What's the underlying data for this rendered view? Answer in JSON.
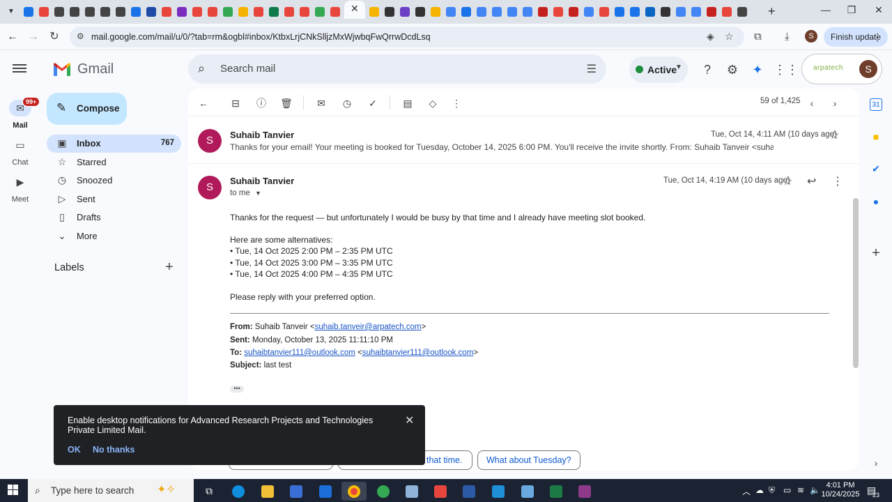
{
  "browser": {
    "url": "mail.google.com/mail/u/0/?tab=rm&ogbl#inbox/KtbxLrjCNkSlljzMxWjwbqFwQrrwDcdLsq",
    "finish_update_label": "Finish update",
    "profile_initial": "S",
    "tab_favicons": [
      "#1a73e8",
      "#e8453c",
      "#444",
      "#444",
      "#444",
      "#444",
      "#444",
      "#1a73e8",
      "#1f4aa8",
      "#e8453c",
      "#7b2cbf",
      "#e8453c",
      "#e8453c",
      "#34a853",
      "#f4b400",
      "#e8453c",
      "#0f7b4a",
      "#e8453c",
      "#e8453c",
      "#34a853",
      "#e8453c"
    ],
    "tab_favicons_right": [
      "#f4b400",
      "#333",
      "#6c3fc5",
      "#333",
      "#f4b400",
      "#4285f4",
      "#1a73e8",
      "#4285f4",
      "#4285f4",
      "#4285f4",
      "#4285f4",
      "#c5221f",
      "#e8453c",
      "#c5221f",
      "#4285f4",
      "#e8453c",
      "#1a73e8",
      "#1a73e8",
      "#0a66c2",
      "#333",
      "#4285f4",
      "#4285f4",
      "#c5221f",
      "#e8453c",
      "#444"
    ]
  },
  "gmail": {
    "product_name": "Gmail",
    "search_placeholder": "Search mail",
    "status_label": "Active",
    "org_label": "arpatech",
    "account_initial": "S"
  },
  "rail": {
    "mail_label": "Mail",
    "mail_badge": "99+",
    "chat_label": "Chat",
    "meet_label": "Meet"
  },
  "sidebar": {
    "compose_label": "Compose",
    "items": [
      {
        "label": "Inbox",
        "count": "767",
        "icon": "inbox-icon"
      },
      {
        "label": "Starred",
        "count": "",
        "icon": "star-icon"
      },
      {
        "label": "Snoozed",
        "count": "",
        "icon": "clock-icon"
      },
      {
        "label": "Sent",
        "count": "",
        "icon": "send-icon"
      },
      {
        "label": "Drafts",
        "count": "",
        "icon": "draft-icon"
      },
      {
        "label": "More",
        "count": "",
        "icon": "chevron-down-icon"
      }
    ],
    "labels_title": "Labels"
  },
  "thread": {
    "pager_text": "59 of 1,425",
    "msg1": {
      "avatar": "S",
      "sender": "Suhaib Tanvier",
      "date": "Tue, Oct 14, 4:11 AM (10 days ago)",
      "snippet": "Thanks for your email! Your meeting is booked for Tuesday, October 14, 2025 6:00 PM. You'll receive the invite shortly. From: Suhaib Tanveir <suhaib.tanveir@arp"
    },
    "msg2": {
      "avatar": "S",
      "sender": "Suhaib Tanvier",
      "to_me": "to me",
      "date": "Tue, Oct 14, 4:19 AM (10 days ago)",
      "body_line1": "Thanks for the request — but unfortunately I would be busy by that time and I already have meeting slot booked.",
      "body_line2": "Here are some alternatives:",
      "alt1": "• Tue, 14 Oct 2025 2:00 PM – 2:35 PM UTC",
      "alt2": "• Tue, 14 Oct 2025 3:00 PM – 3:35 PM UTC",
      "alt3": "• Tue, 14 Oct 2025 4:00 PM – 4:35 PM UTC",
      "body_line3": "Please reply with your preferred option.",
      "from_label": "From:",
      "from_name": "Suhaib Tanveir <",
      "from_email": "suhaib.tanveir@arpatech.com",
      "from_close": ">",
      "sent_label": "Sent:",
      "sent_value": "Monday, October 13, 2025 11:11:10 PM",
      "to_label": "To:",
      "to_email1": "suhaibtanvier111@outlook.com",
      "to_open": "<",
      "to_email2": "suhaibtanvier111@outlook.com",
      "to_close": ">",
      "subject_label": "Subject:",
      "subject_value": "last test",
      "ellipsis": "•••"
    },
    "smart_replies": [
      "that time.",
      "What about Tuesday?"
    ]
  },
  "toast": {
    "message": "Enable desktop notifications for Advanced Research Projects and Technologies Private Limited Mail.",
    "ok_label": "OK",
    "no_thanks_label": "No thanks"
  },
  "taskbar": {
    "search_placeholder": "Type here to search",
    "time": "4:01 PM",
    "date": "10/24/2025",
    "notification_count": "23"
  }
}
